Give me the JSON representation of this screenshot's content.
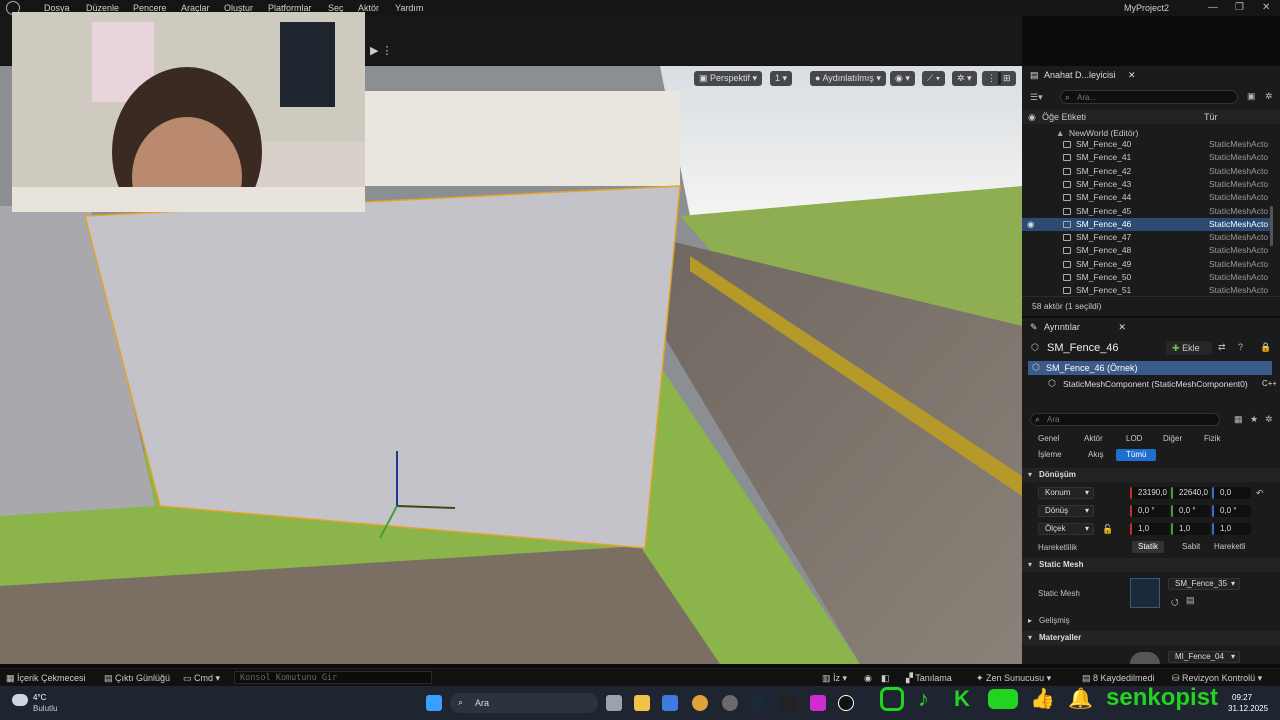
{
  "menubar": {
    "items": [
      "Dosya",
      "Düzenle",
      "Pencere",
      "Araçlar",
      "Oluştur",
      "Platformlar",
      "Seç",
      "Aktör",
      "Yardım"
    ],
    "project_name": "MyProject2"
  },
  "viewport": {
    "perspective_label": "Perspektif",
    "lit_label": "Aydınlatılmış",
    "camera_speed": "1"
  },
  "outliner": {
    "tab_label": "Anahat D...leyicisi",
    "search_placeholder": "Ara...",
    "col_label": "Öğe Etiketi",
    "col_type": "Tür",
    "world_label": "NewWorld (Editör)",
    "rows": [
      {
        "name": "SM_Fence_40",
        "type": "StaticMeshActo"
      },
      {
        "name": "SM_Fence_41",
        "type": "StaticMeshActo"
      },
      {
        "name": "SM_Fence_42",
        "type": "StaticMeshActo"
      },
      {
        "name": "SM_Fence_43",
        "type": "StaticMeshActo"
      },
      {
        "name": "SM_Fence_44",
        "type": "StaticMeshActo"
      },
      {
        "name": "SM_Fence_45",
        "type": "StaticMeshActo"
      },
      {
        "name": "SM_Fence_46",
        "type": "StaticMeshActo"
      },
      {
        "name": "SM_Fence_47",
        "type": "StaticMeshActo"
      },
      {
        "name": "SM_Fence_48",
        "type": "StaticMeshActo"
      },
      {
        "name": "SM_Fence_49",
        "type": "StaticMeshActo"
      },
      {
        "name": "SM_Fence_50",
        "type": "StaticMeshActo"
      },
      {
        "name": "SM_Fence_51",
        "type": "StaticMeshActo"
      }
    ],
    "selected_index": 6,
    "footer": "58 aktör (1 seçildi)"
  },
  "details": {
    "tab_label": "Ayrıntılar",
    "actor_name": "SM_Fence_46",
    "add_label": "Ekle",
    "instance_label": "SM_Fence_46 (Örnek)",
    "component_label": "StaticMeshComponent (StaticMeshComponent0)",
    "cpp_label": "C++ S",
    "search_placeholder": "Ara",
    "filters_row1": [
      "Genel",
      "Aktör",
      "LOD",
      "Diğer",
      "Fizik"
    ],
    "filters_row2": [
      "İşleme",
      "Akış",
      "Tümü"
    ],
    "transform_section": "Dönüşüm",
    "location_label": "Konum",
    "location": [
      "23190,0",
      "22640,0",
      "0,0"
    ],
    "rotation_label": "Dönüş",
    "rotation": [
      "0,0 °",
      "0,0 °",
      "0,0 °"
    ],
    "scale_label": "Ölçek",
    "scale": [
      "1,0",
      "1,0",
      "1,0"
    ],
    "mobility_label": "Hareketlilik",
    "mobility_options": [
      "Statik",
      "Sabit",
      "Hareketli"
    ],
    "static_mesh_section": "Static Mesh",
    "static_mesh_label": "Static Mesh",
    "static_mesh_value": "SM_Fence_35",
    "advanced_label": "Gelişmiş",
    "materials_section": "Materyaller",
    "material_value": "MI_Fence_04"
  },
  "statusbar": {
    "content_drawer": "İçerik Çekmecesi",
    "output_log": "Çıktı Günlüğü",
    "cmd_label": "Cmd",
    "console_placeholder": "Konsol Komutunu Gir",
    "trace_label": "İz",
    "derived_label": "Tanılama",
    "zen_label": "Zen Sunucusu",
    "unsaved_label": "8 Kaydedilmedi",
    "revision_label": "Revizyon Kontrolü"
  },
  "taskbar": {
    "weather_temp": "4°C",
    "weather_desc": "Bulutlu",
    "search_label": "Ara",
    "time": "09:27",
    "date": "31.12.2025",
    "channel_name": "senkopist"
  },
  "colors": {
    "accent": "#1f6fd1",
    "selection": "#2d4a73",
    "overlay_green": "#22d41f"
  }
}
